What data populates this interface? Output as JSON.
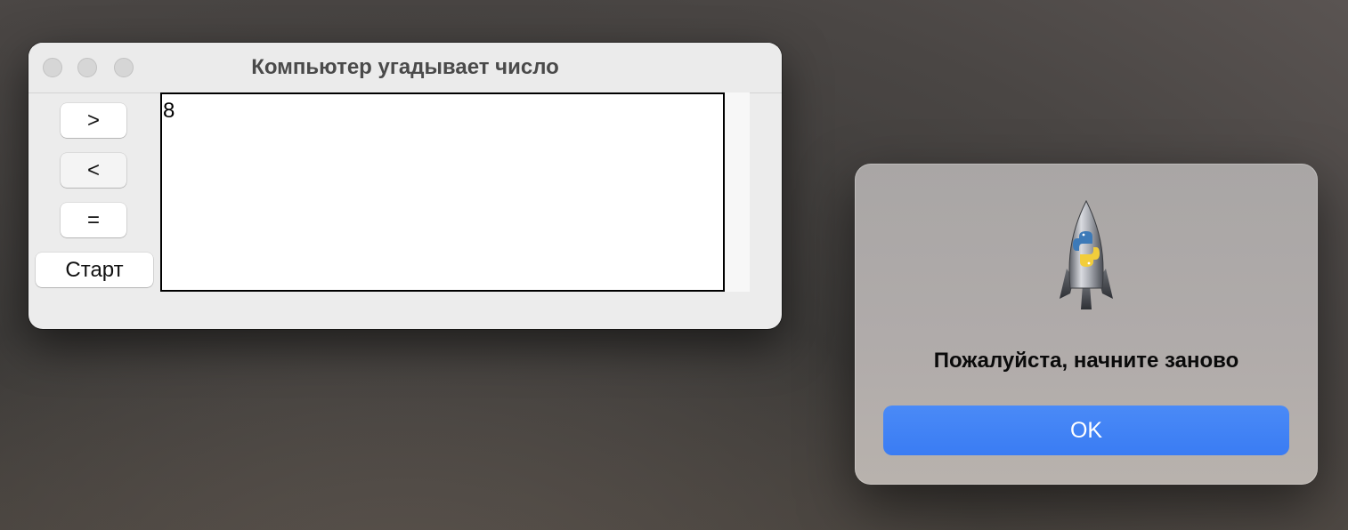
{
  "window": {
    "title": "Компьютер угадывает число",
    "buttons": {
      "greater": ">",
      "less": "<",
      "equal": "=",
      "start": "Старт"
    },
    "output_text": "8"
  },
  "dialog": {
    "icon": "python-launcher-rocket-icon",
    "message": "Пожалуйста, начните заново",
    "ok_label": "OK"
  },
  "colors": {
    "accent": "#3a7cf3",
    "window_bg": "#ececec",
    "dialog_bg": "#aeaaa8"
  }
}
